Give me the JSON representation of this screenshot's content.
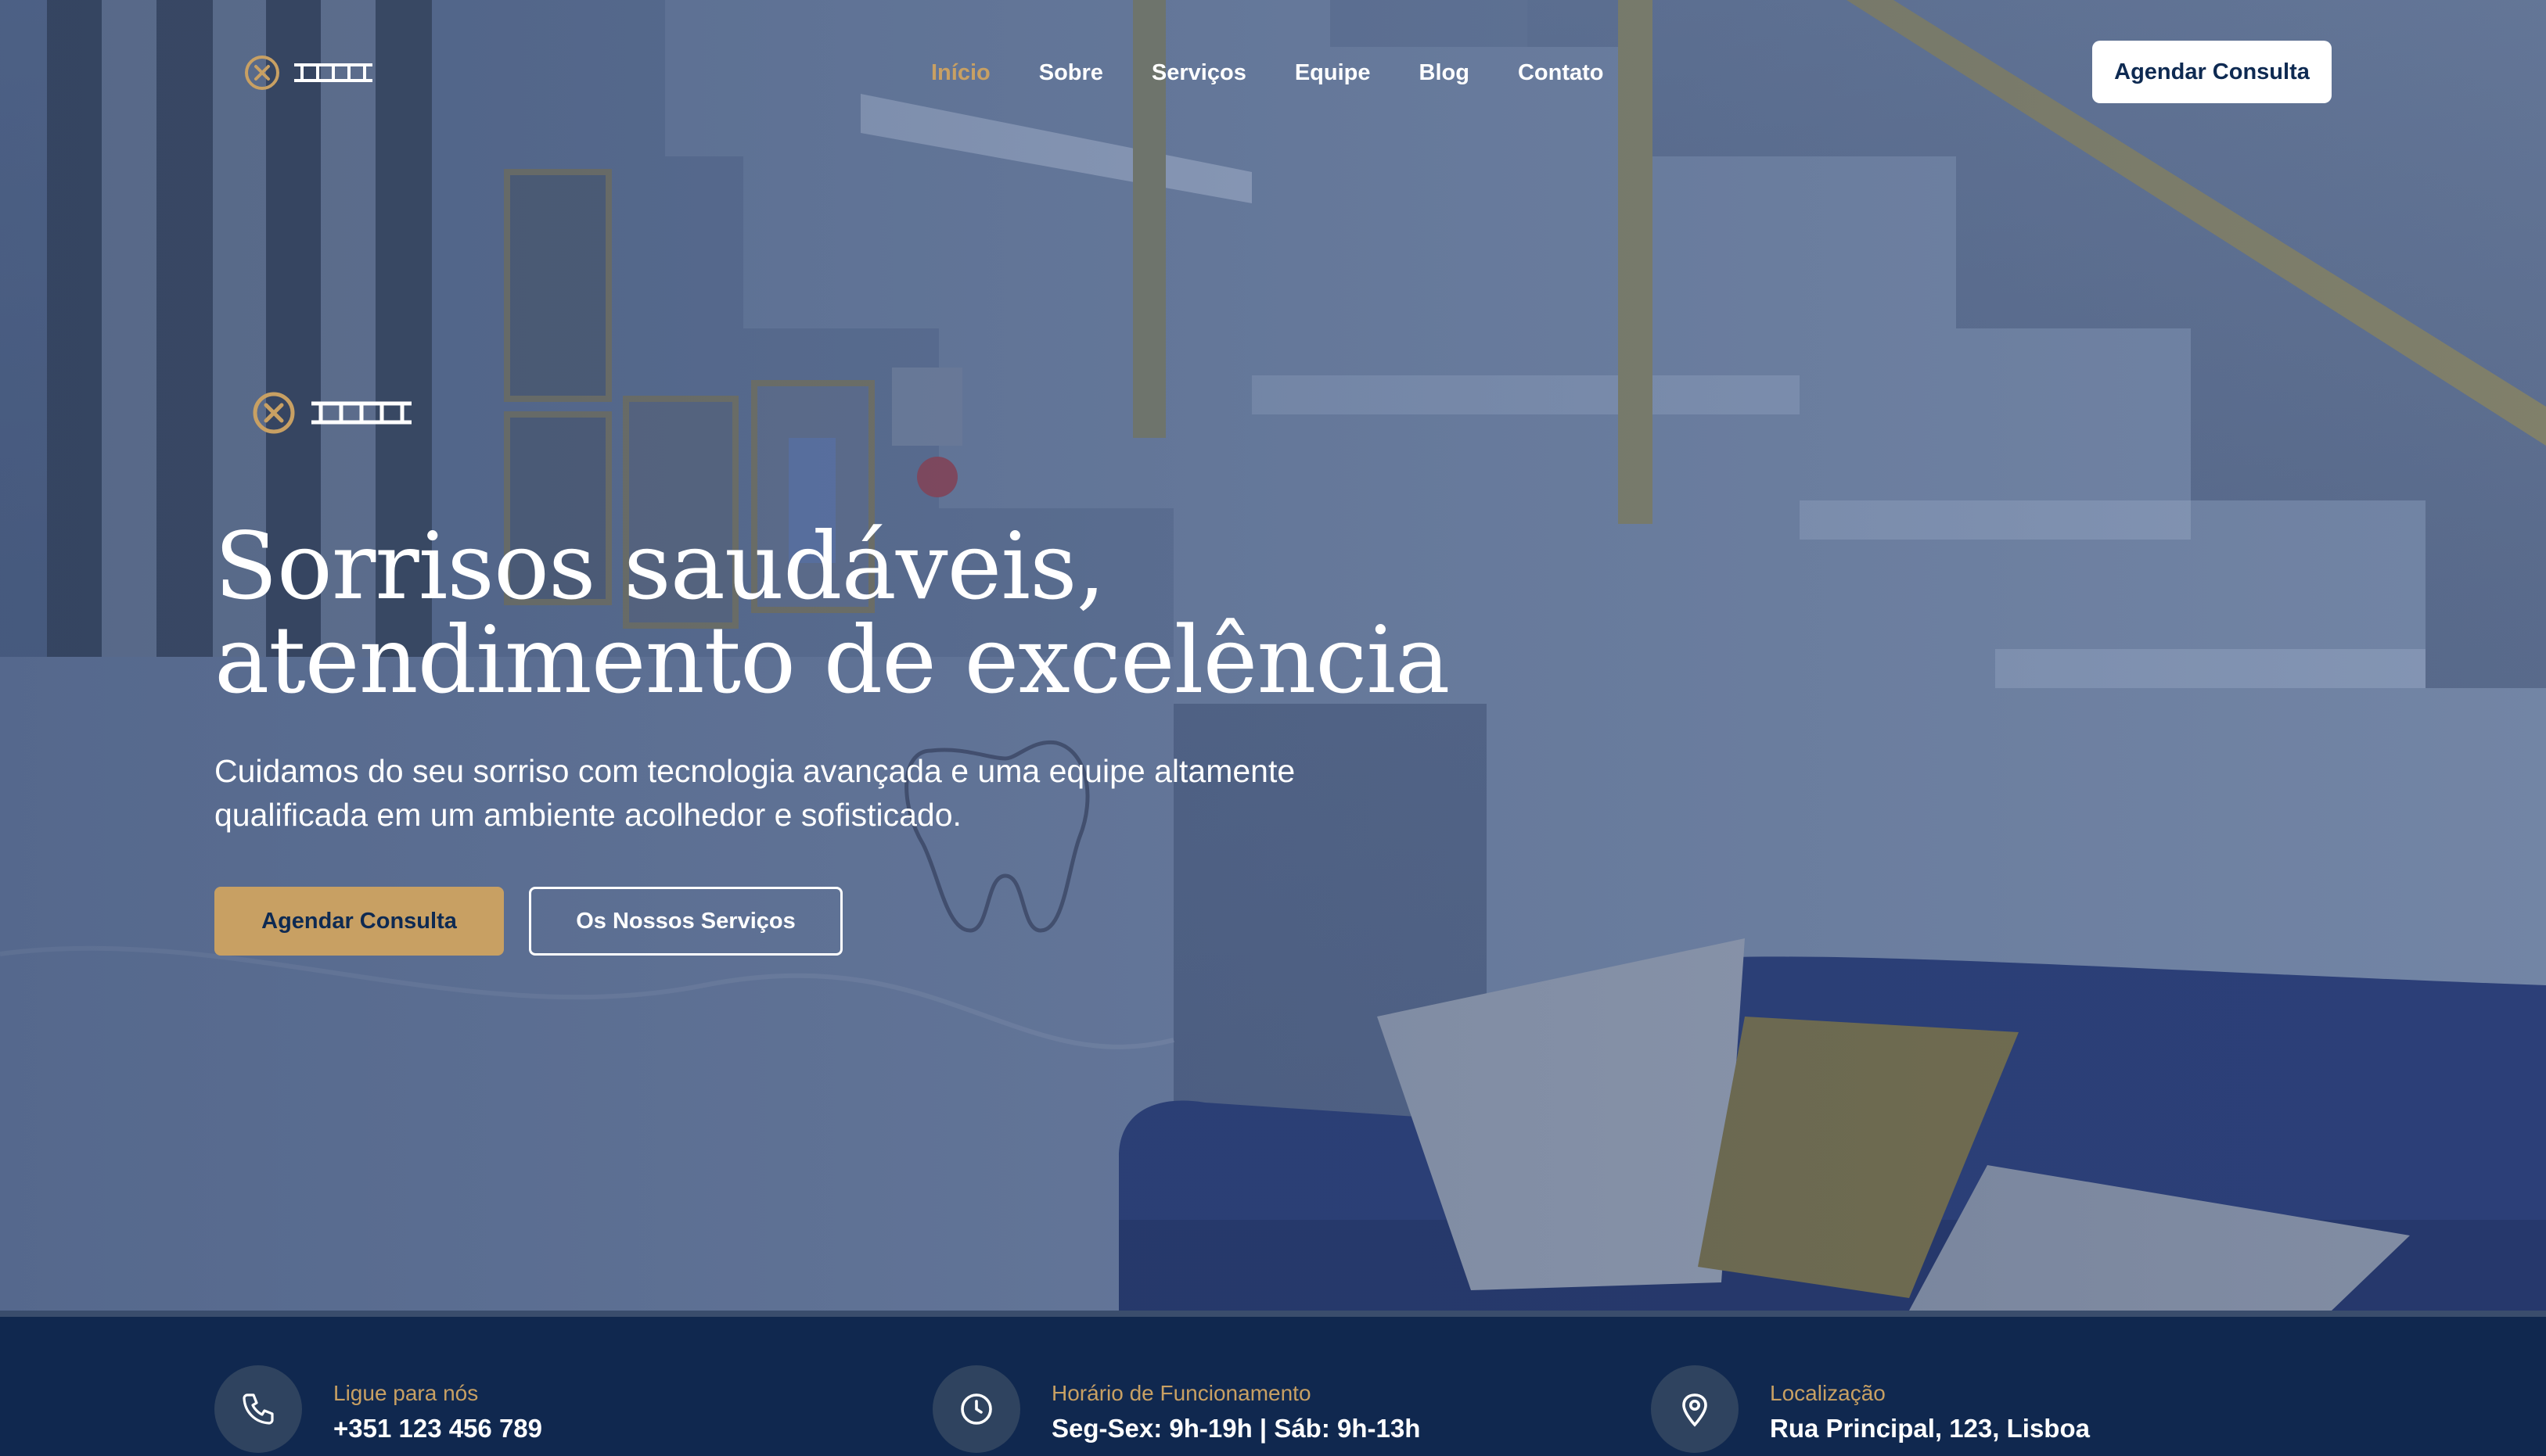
{
  "brand": {
    "logo_icon": "x-circle-icon",
    "colors": {
      "gold": "#c8a063",
      "navy": "#10284f",
      "white": "#ffffff"
    }
  },
  "nav": {
    "items": [
      {
        "label": "Início",
        "active": true
      },
      {
        "label": "Sobre",
        "active": false
      },
      {
        "label": "Serviços",
        "active": false
      },
      {
        "label": "Equipe",
        "active": false
      },
      {
        "label": "Blog",
        "active": false
      },
      {
        "label": "Contato",
        "active": false
      }
    ],
    "cta_label": "Agendar Consulta"
  },
  "hero": {
    "title_line1": "Sorrisos saudáveis,",
    "title_line2": "atendimento de excelência",
    "subtitle_line1": "Cuidamos do seu sorriso com tecnologia avançada e uma equipe altamente",
    "subtitle_line2": "qualificada em um ambiente acolhedor e sofisticado.",
    "primary_button": "Agendar Consulta",
    "secondary_button": "Os Nossos Serviços"
  },
  "info": [
    {
      "icon": "phone-icon",
      "label": "Ligue para nós",
      "value": "+351 123 456 789"
    },
    {
      "icon": "clock-icon",
      "label": "Horário de Funcionamento",
      "value": "Seg-Sex: 9h-19h | Sáb: 9h-13h"
    },
    {
      "icon": "map-pin-icon",
      "label": "Localização",
      "value": "Rua Principal, 123, Lisboa"
    }
  ]
}
